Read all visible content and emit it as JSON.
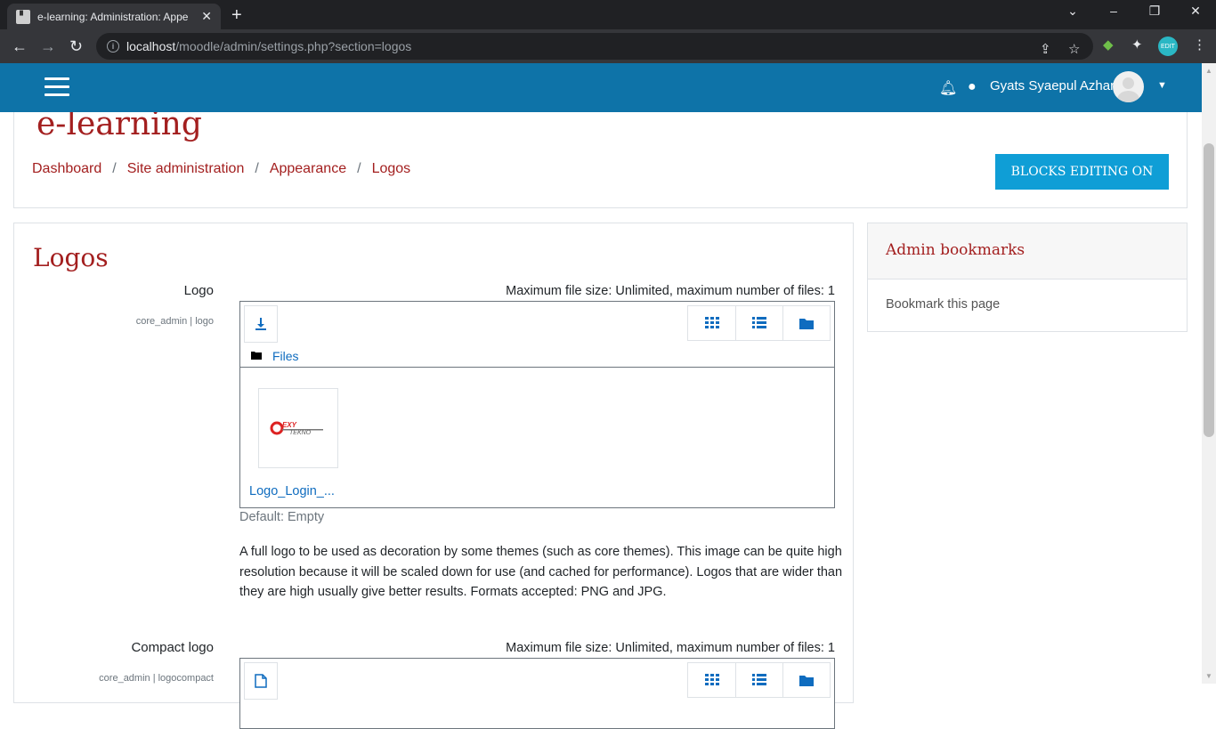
{
  "browser": {
    "tab_title": "e-learning: Administration: Appe",
    "tab_close": "✕",
    "new_tab": "+",
    "url_host": "localhost",
    "url_path": "/moodle/admin/settings.php?section=logos",
    "profile_initials": "EDIT"
  },
  "navbar": {
    "username": "Gyats Syaepul Azhar"
  },
  "header": {
    "site_title": "e-learning",
    "breadcrumb": [
      "Dashboard",
      "Site administration",
      "Appearance",
      "Logos"
    ],
    "breadcrumb_sep": "/",
    "blocks_button": "BLOCKS EDITING ON"
  },
  "main": {
    "heading": "Logos",
    "settings": [
      {
        "label": "Logo",
        "sub": "core_admin | logo",
        "maxsize": "Maximum file size: Unlimited, maximum number of files: 1",
        "path_label": "Files",
        "file_name": "Logo_Login_...",
        "logo_text": "NEXY TEKNO",
        "default": "Default: Empty",
        "description": "A full logo to be used as decoration by some themes (such as core themes). This image can be quite high resolution because it will be scaled down for use (and cached for performance). Logos that are wider than they are high usually give better results. Formats accepted: PNG and JPG."
      },
      {
        "label": "Compact logo",
        "sub": "core_admin | logocompact",
        "maxsize": "Maximum file size: Unlimited, maximum number of files: 1"
      }
    ]
  },
  "block": {
    "title": "Admin bookmarks",
    "link": "Bookmark this page"
  },
  "colors": {
    "navbar": "#0e73a8",
    "brand_red": "#a31f1f",
    "button_blue": "#0f9ed6",
    "link_blue": "#0f6cbf"
  }
}
